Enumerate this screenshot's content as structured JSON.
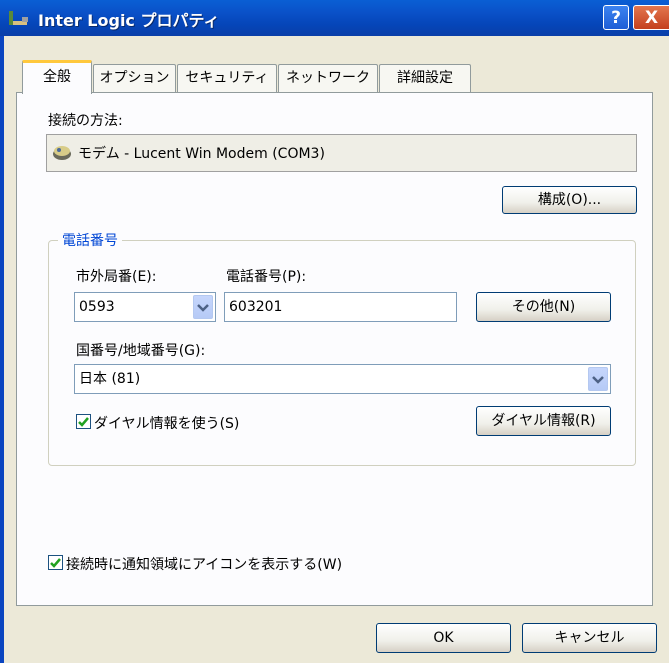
{
  "window": {
    "title": "Inter Logic プロパティ",
    "help_label": "?",
    "close_label": "X"
  },
  "tabs": [
    {
      "label": "全般",
      "active": true
    },
    {
      "label": "オプション"
    },
    {
      "label": "セキュリティ"
    },
    {
      "label": "ネットワーク"
    },
    {
      "label": "詳細設定"
    }
  ],
  "general": {
    "connect_using_label": "接続の方法:",
    "device": "モデム - Lucent Win Modem (COM3)",
    "configure_button": "構成(O)..."
  },
  "phone_number": {
    "group_title": "電話番号",
    "area_code_label": "市外局番(E):",
    "area_code_value": "0593",
    "phone_label": "電話番号(P):",
    "phone_value": "603201",
    "other_button": "その他(N)",
    "country_label": "国番号/地域番号(G):",
    "country_value": "日本 (81)",
    "use_dialing_rules_label": "ダイヤル情報を使う(S)",
    "use_dialing_rules_checked": true,
    "dialing_rules_button": "ダイヤル情報(R)"
  },
  "notify_icon_label": "接続時に通知領域にアイコンを表示する(W)",
  "notify_icon_checked": true,
  "buttons": {
    "ok": "OK",
    "cancel": "キャンセル"
  }
}
